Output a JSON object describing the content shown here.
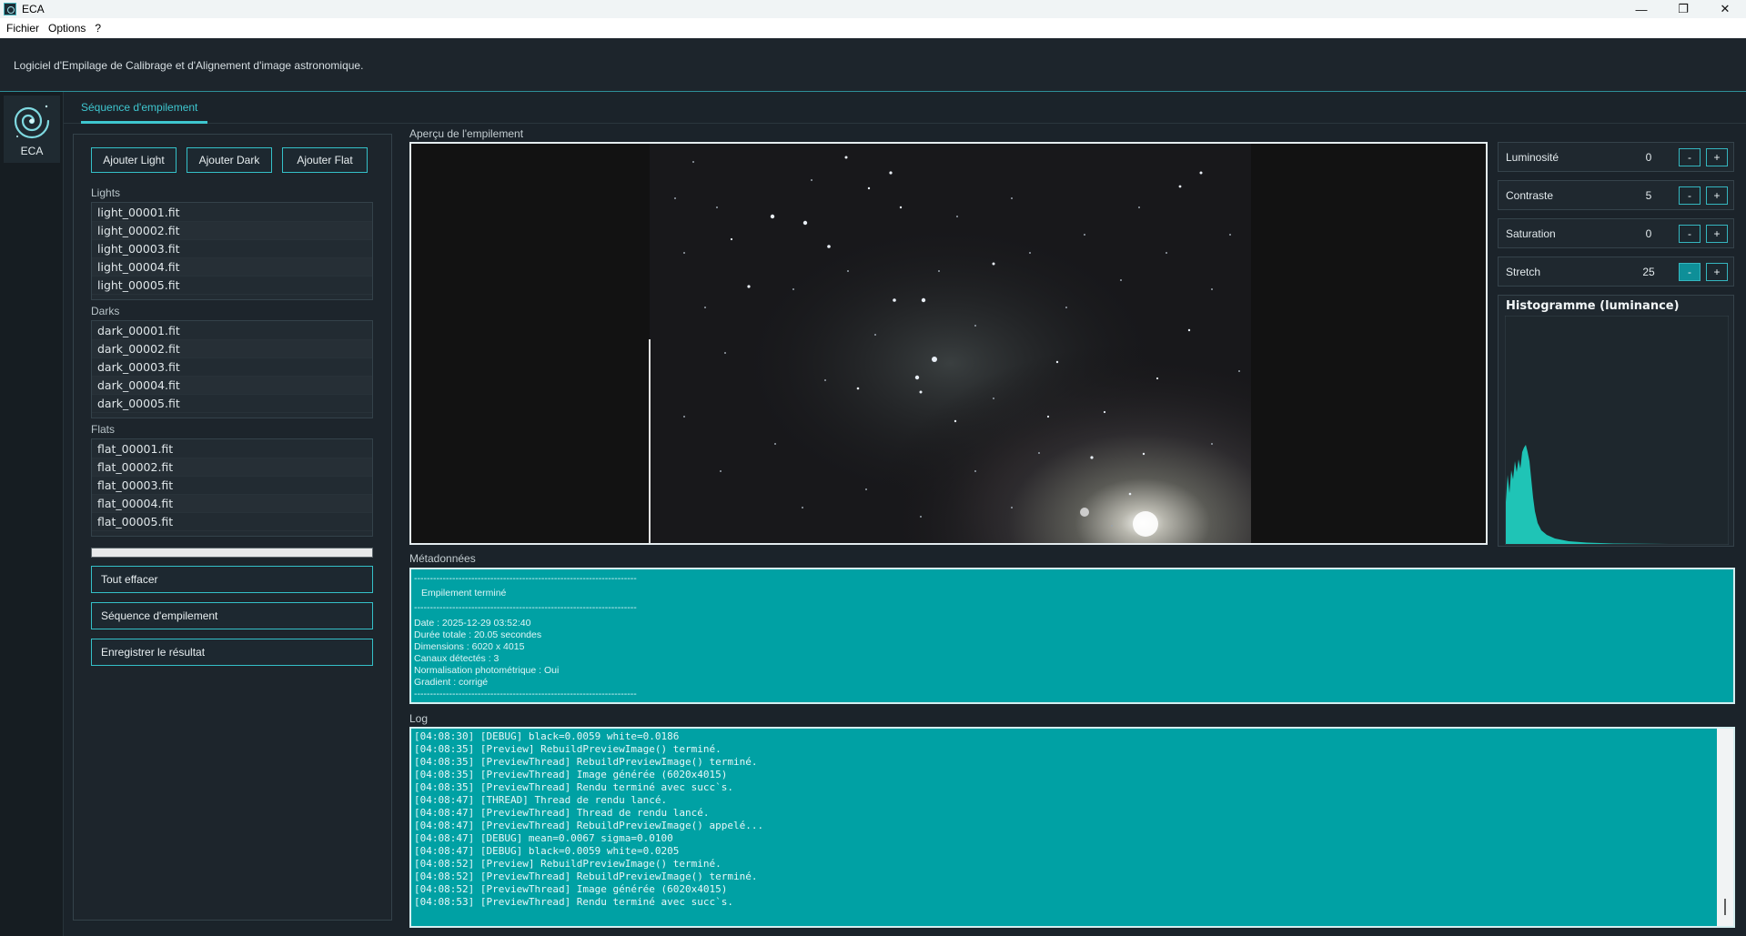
{
  "window": {
    "title": "ECA",
    "controls": {
      "minimize": "—",
      "maximize": "❐",
      "close": "✕"
    }
  },
  "menu": {
    "items": [
      "Fichier",
      "Options",
      "?"
    ]
  },
  "header": {
    "subtitle": "Logiciel d'Empilage de Calibrage et d'Alignement d'image astronomique."
  },
  "rail": {
    "label": "ECA"
  },
  "tabs": {
    "active": "Séquence d'empilement"
  },
  "left": {
    "buttons": {
      "add_light": "Ajouter Light",
      "add_dark": "Ajouter Dark",
      "add_flat": "Ajouter Flat"
    },
    "lights_label": "Lights",
    "lights": [
      "light_00001.fit",
      "light_00002.fit",
      "light_00003.fit",
      "light_00004.fit",
      "light_00005.fit"
    ],
    "darks_label": "Darks",
    "darks": [
      "dark_00001.fit",
      "dark_00002.fit",
      "dark_00003.fit",
      "dark_00004.fit",
      "dark_00005.fit"
    ],
    "flats_label": "Flats",
    "flats": [
      "flat_00001.fit",
      "flat_00002.fit",
      "flat_00003.fit",
      "flat_00004.fit",
      "flat_00005.fit"
    ],
    "progress": 0,
    "actions": {
      "clear": "Tout effacer",
      "sequence": "Séquence d'empilement",
      "save": "Enregistrer le résultat"
    }
  },
  "preview": {
    "label": "Aperçu de l'empilement"
  },
  "adjust": {
    "luminosite": {
      "name": "Luminosité",
      "value": "0"
    },
    "contraste": {
      "name": "Contraste",
      "value": "5"
    },
    "saturation": {
      "name": "Saturation",
      "value": "0"
    },
    "stretch": {
      "name": "Stretch",
      "value": "25"
    },
    "minus": "-",
    "plus": "+"
  },
  "histogram": {
    "title": "Histogramme (luminance)",
    "color": "#1fc4b6"
  },
  "metadata": {
    "label": "Métadonnées",
    "separator": "----------------------------------------------------------------------",
    "heading": "Empilement terminé",
    "lines": [
      "Date : 2025-12-29  03:52:40",
      "Durée totale : 20.05 secondes",
      "Dimensions : 6020 x 4015",
      "Canaux détectés : 3",
      "Normalisation photométrique : Oui",
      "Gradient : corrigé"
    ]
  },
  "log": {
    "label": "Log",
    "lines": [
      "[04:08:30] [DEBUG] black=0.0059 white=0.0186",
      "[04:08:35] [Preview] RebuildPreviewImage() terminé.",
      "[04:08:35] [PreviewThread] RebuildPreviewImage() terminé.",
      "[04:08:35] [PreviewThread] Image générée (6020x4015)",
      "[04:08:35] [PreviewThread] Rendu terminé avec succ`s.",
      "[04:08:47] [THREAD] Thread de rendu lancé.",
      "[04:08:47] [PreviewThread] Thread de rendu lancé.",
      "[04:08:47] [PreviewThread] RebuildPreviewImage() appelé...",
      "[04:08:47] [DEBUG] mean=0.0067 sigma=0.0100",
      "[04:08:47] [DEBUG] black=0.0059 white=0.0205",
      "[04:08:52] [Preview] RebuildPreviewImage() terminé.",
      "[04:08:52] [PreviewThread] RebuildPreviewImage() terminé.",
      "[04:08:52] [PreviewThread] Image générée (6020x4015)",
      "[04:08:53] [PreviewThread] Rendu terminé avec succ`s."
    ]
  },
  "colors": {
    "accent": "#3ec6cf",
    "teal_panel": "#00a1a4",
    "background": "#1b232a"
  }
}
